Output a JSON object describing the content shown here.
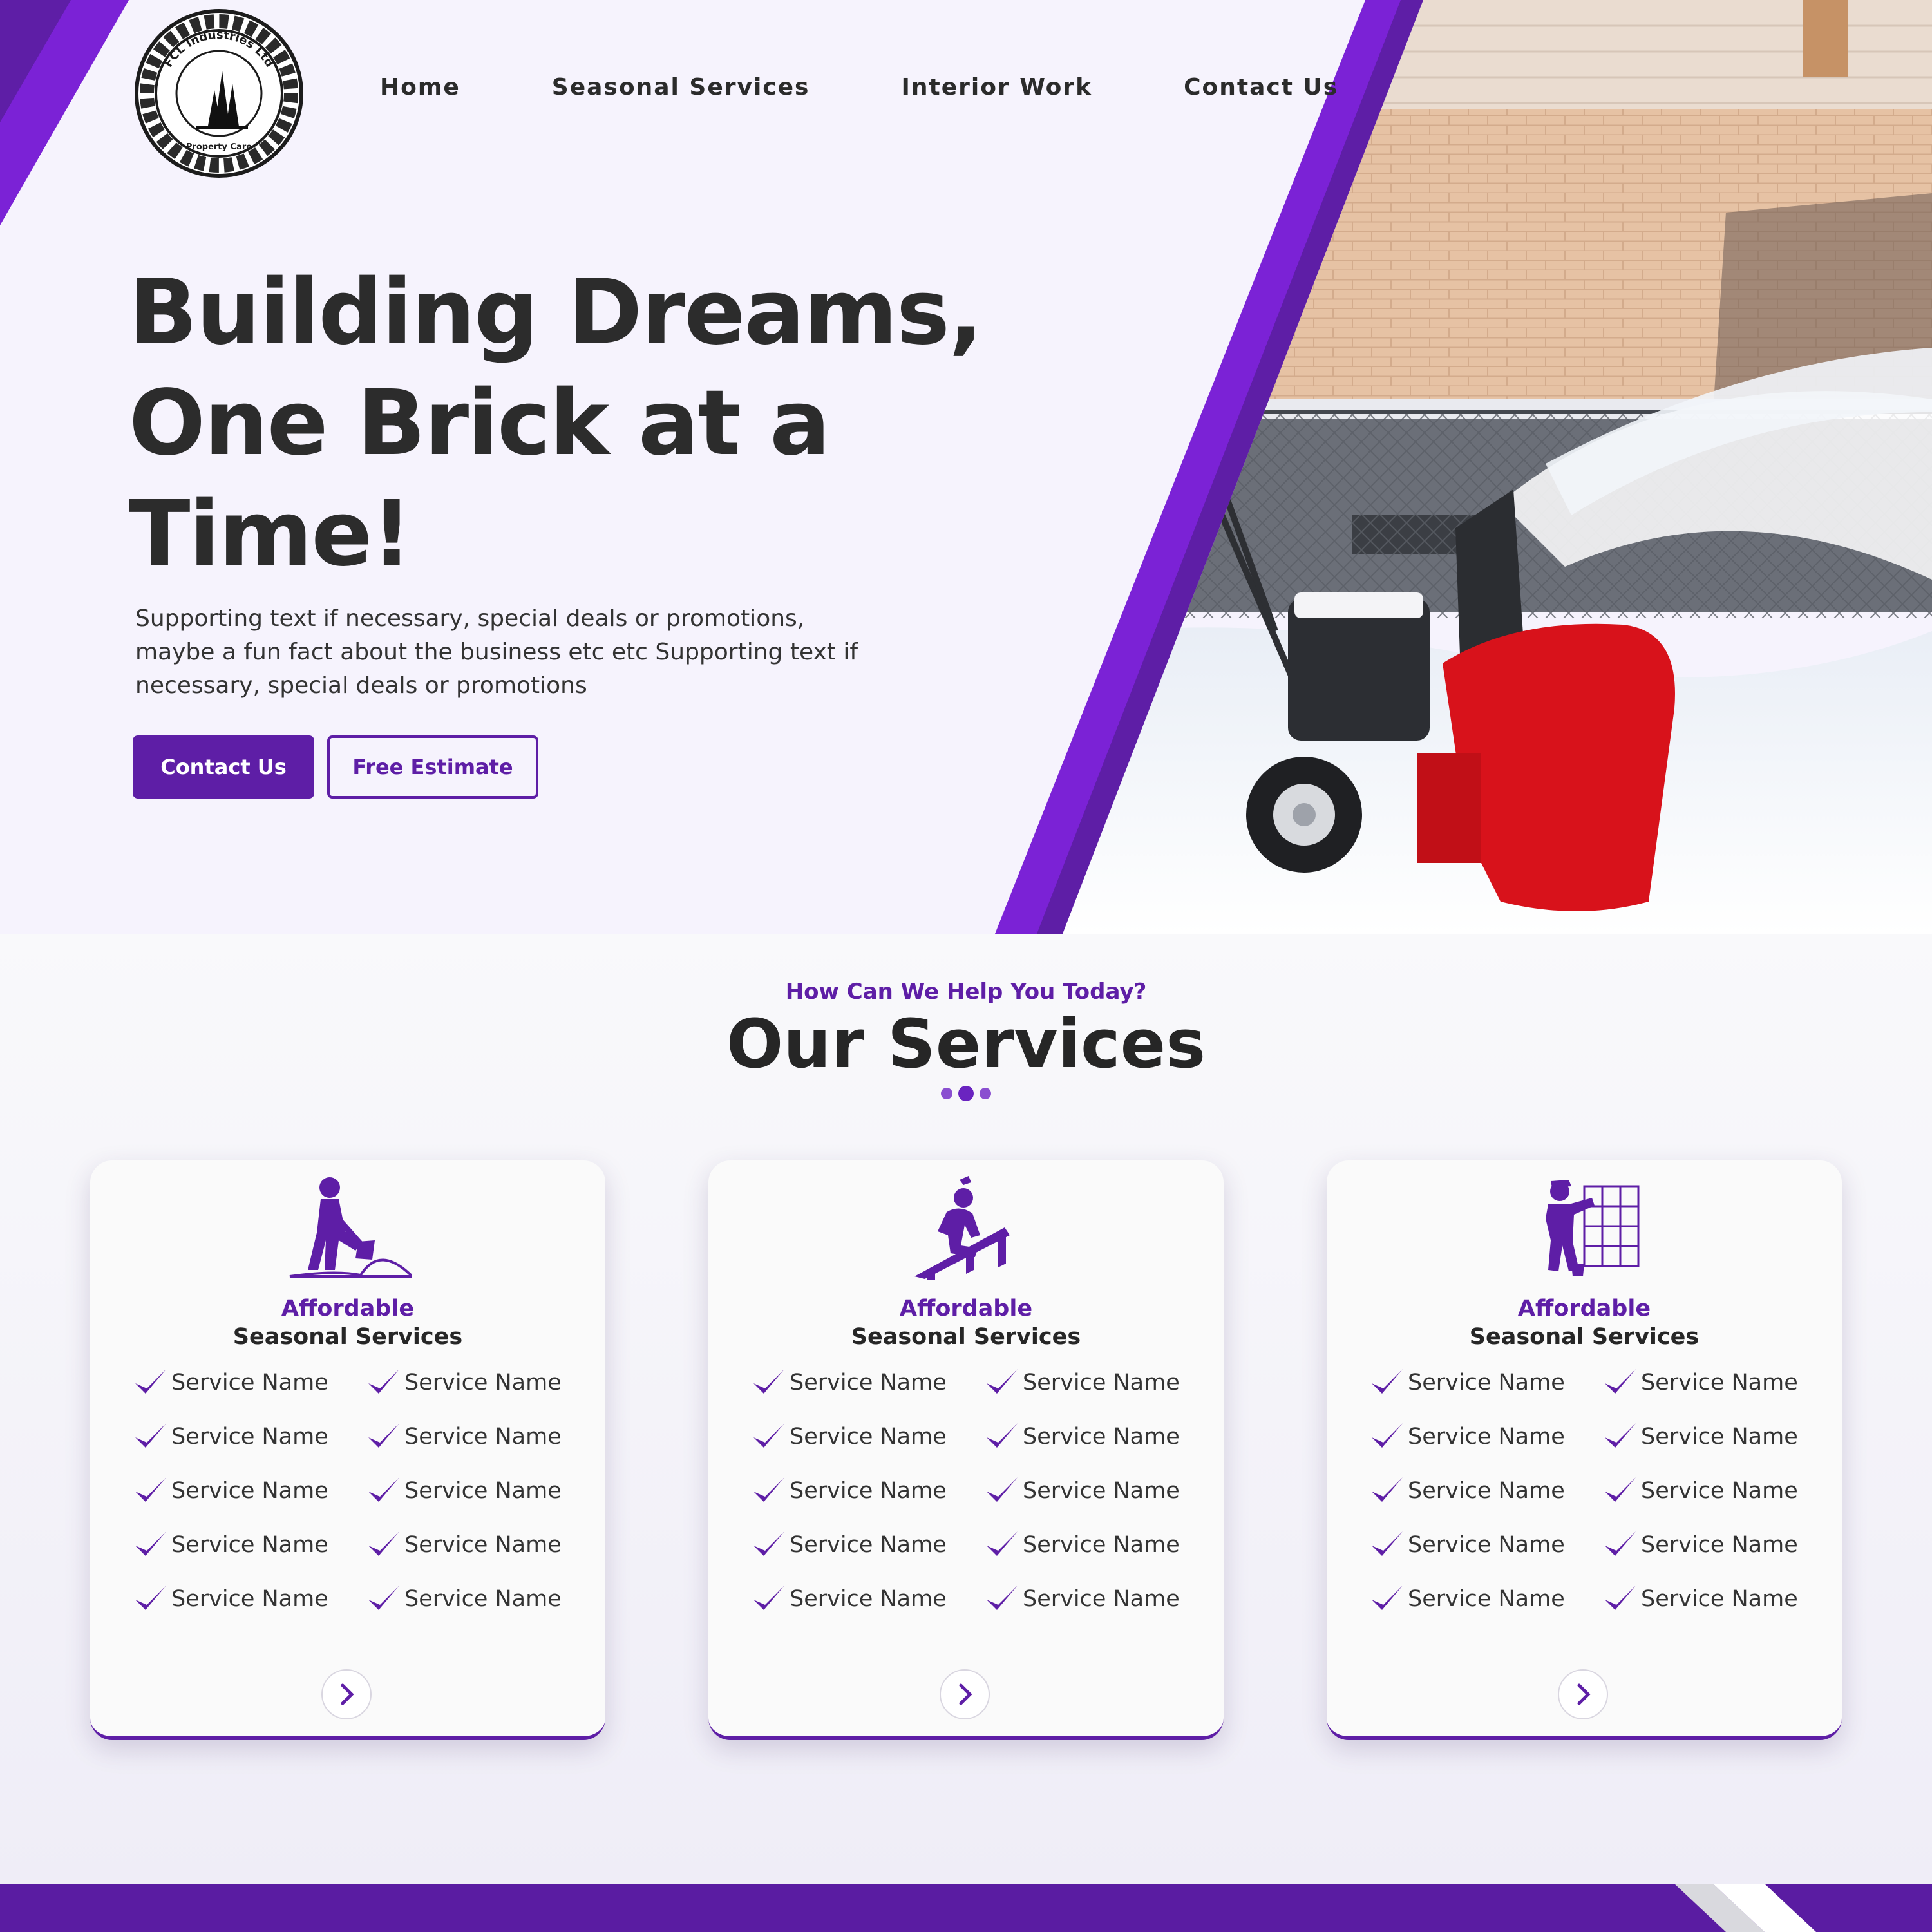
{
  "brand": {
    "logo_ring_text": "FCL Industries Ltd",
    "logo_bottom_text": "Property Care"
  },
  "nav": {
    "items": [
      "Home",
      "Seasonal Services",
      "Interior Work",
      "Contact Us"
    ]
  },
  "hero": {
    "title": "Building Dreams, One Brick at a Time!",
    "subtitle": "Supporting text if necessary, special deals or promotions, maybe a fun fact about the business etc etc Supporting text if necessary, special deals or promotions",
    "primary_button": "Contact Us",
    "secondary_button": "Free Estimate",
    "image": "snowblower-clearing-snow"
  },
  "services": {
    "kicker": "How Can We Help You Today?",
    "title": "Our Services",
    "cards": [
      {
        "icon": "snow-shoveling-worker-icon",
        "subtitle": "Affordable",
        "title": "Seasonal Services",
        "items": [
          "Service Name",
          "Service Name",
          "Service Name",
          "Service Name",
          "Service Name",
          "Service Name",
          "Service Name",
          "Service Name",
          "Service Name",
          "Service Name"
        ]
      },
      {
        "icon": "roofer-worker-icon",
        "subtitle": "Affordable",
        "title": "Seasonal Services",
        "items": [
          "Service Name",
          "Service Name",
          "Service Name",
          "Service Name",
          "Service Name",
          "Service Name",
          "Service Name",
          "Service Name",
          "Service Name",
          "Service Name"
        ]
      },
      {
        "icon": "tile-worker-icon",
        "subtitle": "Affordable",
        "title": "Seasonal Services",
        "items": [
          "Service Name",
          "Service Name",
          "Service Name",
          "Service Name",
          "Service Name",
          "Service Name",
          "Service Name",
          "Service Name",
          "Service Name",
          "Service Name"
        ]
      }
    ]
  },
  "colors": {
    "accent": "#5e1ea6",
    "stripe": "#7b22d6",
    "hero_bg": "#f6f3fd",
    "text": "#2a2a2a"
  }
}
